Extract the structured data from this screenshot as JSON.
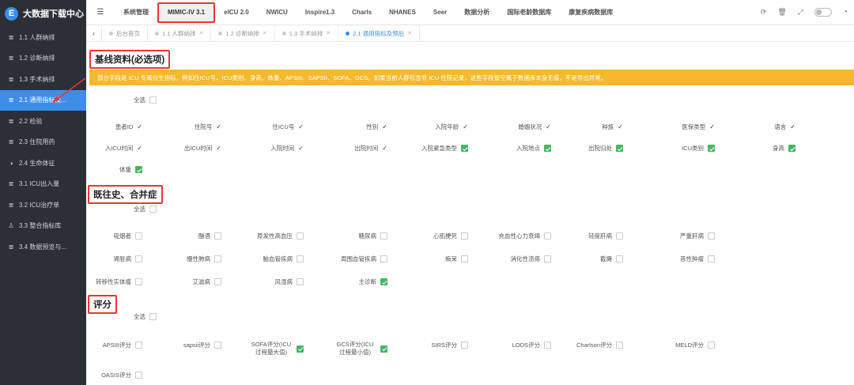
{
  "brand": {
    "title": "大数据下载中心",
    "logo_letter": "E"
  },
  "sidebar": {
    "items": [
      {
        "label": "1.1 人群纳排",
        "icon": "list-icon",
        "active": false
      },
      {
        "label": "1.2 诊断纳排",
        "icon": "list-icon",
        "active": false
      },
      {
        "label": "1.3 手术纳排",
        "icon": "list-icon",
        "active": false
      },
      {
        "label": "2.1 通用指标及...",
        "icon": "list-icon",
        "active": true
      },
      {
        "label": "2.2 检验",
        "icon": "list-icon",
        "active": false
      },
      {
        "label": "2.3 住院用药",
        "icon": "list-icon",
        "active": false
      },
      {
        "label": "2.4 生命体征",
        "icon": "half-circle-icon",
        "active": false
      },
      {
        "label": "3.1 ICU出入量",
        "icon": "list-icon",
        "active": false
      },
      {
        "label": "3.2 ICU治疗单",
        "icon": "list-icon",
        "active": false
      },
      {
        "label": "3.3 整合指标库",
        "icon": "user-icon",
        "active": false
      },
      {
        "label": "3.4 数据预览与...",
        "icon": "list-icon",
        "active": false
      }
    ]
  },
  "topnav": {
    "items": [
      "系统管理",
      "MIMIC-IV 3.1",
      "eICU 2.0",
      "NWICU",
      "Inspire1.3",
      "Charls",
      "NHANES",
      "Seer",
      "数据分析",
      "国际老龄数据库",
      "康复疾病数据库"
    ],
    "active_index": 1
  },
  "tabs": [
    {
      "label": "后台首页",
      "closable": false,
      "active": false
    },
    {
      "label": "1.1 人群纳排",
      "closable": true,
      "active": false
    },
    {
      "label": "1.2 诊断纳排",
      "closable": true,
      "active": false
    },
    {
      "label": "1.3 手术纳排",
      "closable": true,
      "active": false
    },
    {
      "label": "2.1 通用指标及预后",
      "closable": true,
      "active": true
    }
  ],
  "baseline": {
    "title": "基线资料(必选项)",
    "notice": "部分字段是 ICU 专属衍生指标，例如住ICU号、ICU类别、身高、体重、APSIII、SAPSII、SOFA、GCS。如果当前人群包含非 ICU 住院记录，这些字段留空属于数据库本身无值，不是导出异常。",
    "select_all": "全选",
    "fixed_fields": [
      "患者ID",
      "住院号",
      "住ICU号",
      "性别",
      "入院年龄",
      "婚姻状况",
      "种族",
      "医保类型",
      "语言",
      "入ICU时间",
      "出ICU时间",
      "入院时间",
      "出院时间"
    ],
    "fixed_mark": "✓",
    "check_fields": [
      {
        "label": "入院紧急类型",
        "checked": true
      },
      {
        "label": "入院地点",
        "checked": true
      },
      {
        "label": "出院归处",
        "checked": true
      },
      {
        "label": "ICU类别",
        "checked": true
      },
      {
        "label": "身高",
        "checked": true
      },
      {
        "label": "体重",
        "checked": true
      }
    ]
  },
  "history": {
    "title": "既往史、合并症",
    "select_all": "全选",
    "fields": [
      {
        "label": "吸烟者",
        "checked": false
      },
      {
        "label": "酗酒",
        "checked": false
      },
      {
        "label": "原发性高血压",
        "checked": false
      },
      {
        "label": "糖尿病",
        "checked": false
      },
      {
        "label": "心肌梗死",
        "checked": false
      },
      {
        "label": "充血性心力衰竭",
        "checked": false
      },
      {
        "label": "轻度肝病",
        "checked": false
      },
      {
        "label": "严重肝病",
        "checked": false
      },
      {
        "label": "肾脏病",
        "checked": false
      },
      {
        "label": "慢性肺病",
        "checked": false
      },
      {
        "label": "脑血管疾病",
        "checked": false
      },
      {
        "label": "周围血管疾病",
        "checked": false
      },
      {
        "label": "痴呆",
        "checked": false
      },
      {
        "label": "消化性溃疡",
        "checked": false
      },
      {
        "label": "截瘫",
        "checked": false
      },
      {
        "label": "恶性肿瘤",
        "checked": false
      },
      {
        "label": "转移性实体瘤",
        "checked": false
      },
      {
        "label": "艾滋病",
        "checked": false
      },
      {
        "label": "风湿病",
        "checked": false
      },
      {
        "label": "主诊断",
        "checked": true
      }
    ]
  },
  "scores": {
    "title": "评分",
    "select_all": "全选",
    "fields": [
      {
        "label": "APSIII评分",
        "checked": false
      },
      {
        "label": "sapsii评分",
        "checked": false
      },
      {
        "label": "SOFA评分(ICU过程最大值)",
        "checked": true
      },
      {
        "label": "GCS评分(ICU过程最小值)",
        "checked": true
      },
      {
        "label": "SIRS评分",
        "checked": false
      },
      {
        "label": "LODS评分",
        "checked": false
      },
      {
        "label": "Charlson评分",
        "checked": false
      },
      {
        "label": "MELD评分",
        "checked": false
      },
      {
        "label": "OASIS评分",
        "checked": false
      }
    ]
  },
  "colors": {
    "sidebar_bg": "#2b3036",
    "accent": "#3d8ee8",
    "notice_bg": "#f5b82e",
    "check_green": "#46b764",
    "highlight_red": "#e53935"
  }
}
